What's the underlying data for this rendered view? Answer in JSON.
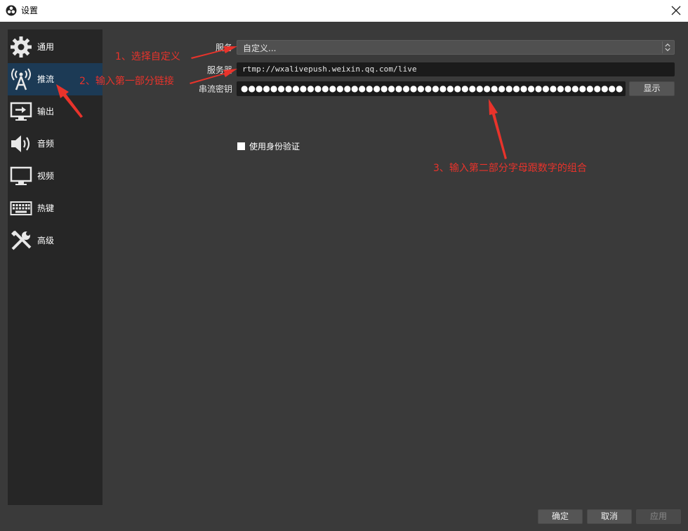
{
  "window": {
    "title": "设置"
  },
  "sidebar": {
    "items": [
      {
        "label": "通用",
        "icon": "gear-icon"
      },
      {
        "label": "推流",
        "icon": "broadcast-antenna-icon"
      },
      {
        "label": "输出",
        "icon": "output-monitor-icon"
      },
      {
        "label": "音频",
        "icon": "speaker-icon"
      },
      {
        "label": "视频",
        "icon": "monitor-icon"
      },
      {
        "label": "热键",
        "icon": "keyboard-icon"
      },
      {
        "label": "高级",
        "icon": "tools-icon"
      }
    ],
    "active_index": 1
  },
  "stream": {
    "service_label": "服务",
    "service_value": "自定义...",
    "server_label": "服务器",
    "server_value": "rtmp://wxalivepush.weixin.qq.com/live",
    "key_label": "串流密钥",
    "key_value": "●●●●●●●●●●●●●●●●●●●●●●●●●●●●●●●●●●●●●●●●●●●●●●●●●●●●●●●●●●●●●●●●●●●●●●●",
    "show_button": "显示",
    "auth_checkbox_label": "使用身份验证",
    "auth_checked": false
  },
  "footer": {
    "ok": "确定",
    "cancel": "取消",
    "apply": "应用"
  },
  "annotations": {
    "step1": "1、选择自定义",
    "step2": "2、输入第一部分链接",
    "step3": "3、输入第二部分字母跟数字的组合",
    "color": "#e8332b"
  },
  "colors": {
    "background": "#3a3a3a",
    "sidebar": "#262626",
    "active_item": "#1c3a55",
    "field": "#1b1b1b"
  }
}
